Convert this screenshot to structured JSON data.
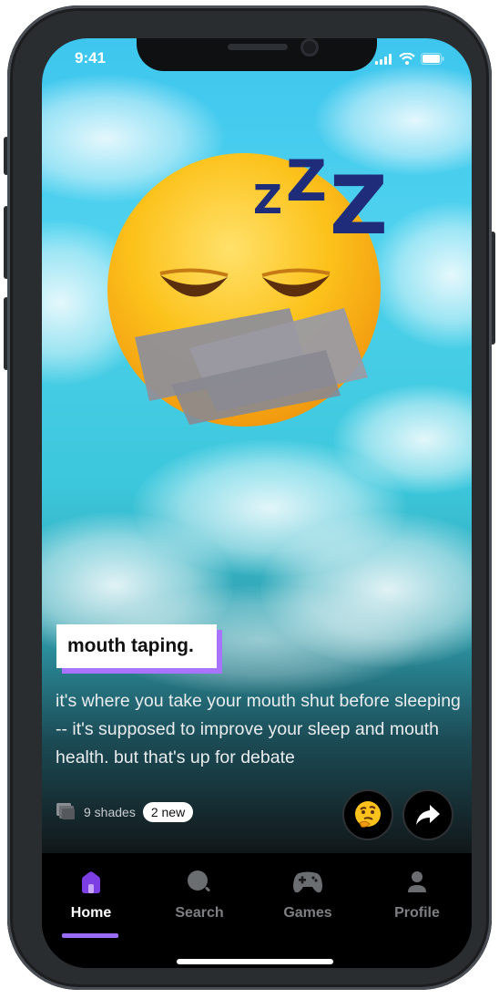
{
  "status_bar": {
    "time": "9:41"
  },
  "card": {
    "title": "mouth taping.",
    "description": "it's where you take your mouth shut before sleeping -- it's supposed to improve your sleep and mouth health. but that's up for debate",
    "shades_count": "9 shades",
    "new_badge": "2 new",
    "reaction_icon": "thinking-face-emoji",
    "share_icon": "share-arrow-icon",
    "illustration": "sleeping-emoji-with-taped-mouth",
    "zzz_text": "ZZZ"
  },
  "nav": {
    "items": [
      {
        "label": "Home",
        "icon": "home-icon",
        "active": true
      },
      {
        "label": "Search",
        "icon": "search-icon",
        "active": false
      },
      {
        "label": "Games",
        "icon": "gamepad-icon",
        "active": false
      },
      {
        "label": "Profile",
        "icon": "profile-icon",
        "active": false
      }
    ]
  },
  "colors": {
    "accent": "#9b6cf5",
    "title_shadow": "#a874ff",
    "sky_top": "#3ec6ee"
  }
}
